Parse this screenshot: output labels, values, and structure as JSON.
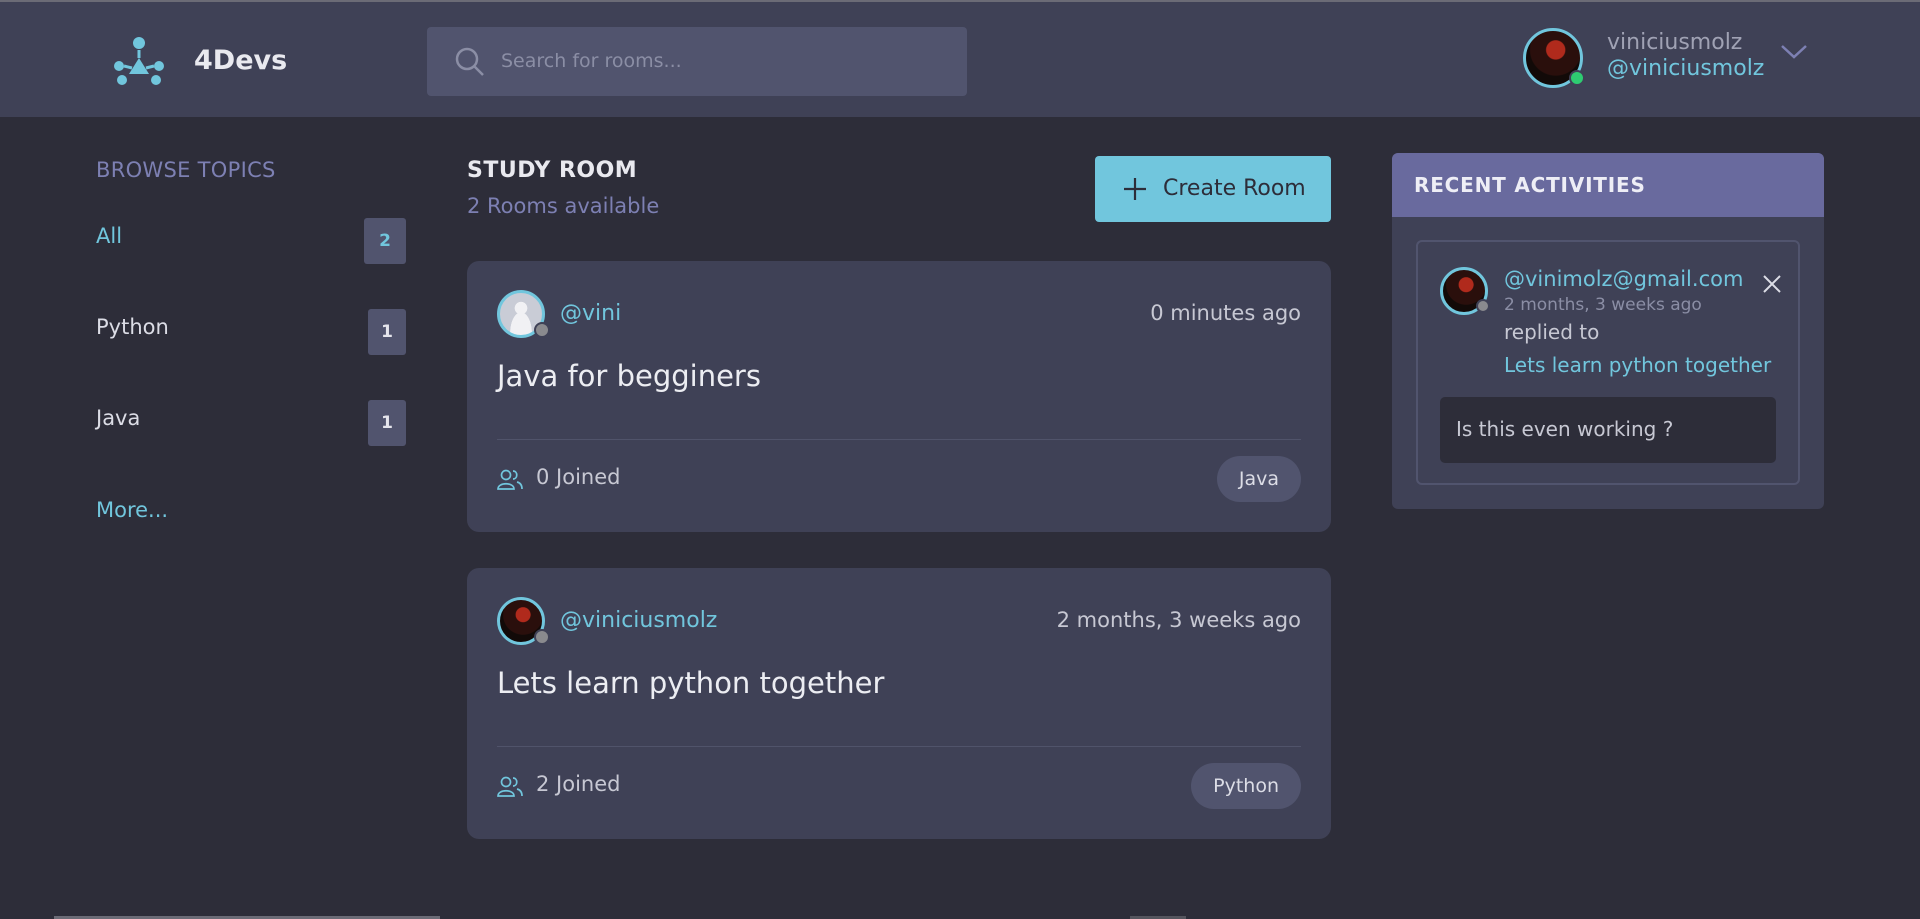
{
  "app": {
    "brand": "4Devs"
  },
  "search": {
    "placeholder": "Search for rooms..."
  },
  "user": {
    "name": "viniciusmolz",
    "handle": "@viniciusmolz"
  },
  "sidebar": {
    "title": "BROWSE TOPICS",
    "topics": [
      {
        "label": "All",
        "count": "2",
        "active": true
      },
      {
        "label": "Python",
        "count": "1",
        "active": false
      },
      {
        "label": "Java",
        "count": "1",
        "active": false
      }
    ],
    "more": "More..."
  },
  "main": {
    "title": "STUDY ROOM",
    "subtitle": "2 Rooms available",
    "create_label": "Create Room",
    "rooms": [
      {
        "host": "@vini",
        "time": "0 minutes ago",
        "name": "Java for begginers",
        "joined": "0 Joined",
        "topic": "Java"
      },
      {
        "host": "@viniciusmolz",
        "time": "2 months, 3 weeks ago",
        "name": "Lets learn python together",
        "joined": "2 Joined",
        "topic": "Python"
      }
    ]
  },
  "activity": {
    "title": "RECENT ACTIVITIES",
    "items": [
      {
        "user": "@vinimolz@gmail.com",
        "time": "2 months, 3 weeks ago",
        "action": "replied to",
        "room": "Lets learn python together",
        "message": "Is this even working ?"
      }
    ]
  },
  "colors": {
    "background": "#2d2d39",
    "surface": "#3f4156",
    "accent": "#71c6dd",
    "muted": "#7d80b3",
    "activity_header": "#696a9e"
  },
  "icons": [
    "logo-icon",
    "search-icon",
    "chevron-down-icon",
    "plus-icon",
    "users-icon",
    "close-icon"
  ]
}
